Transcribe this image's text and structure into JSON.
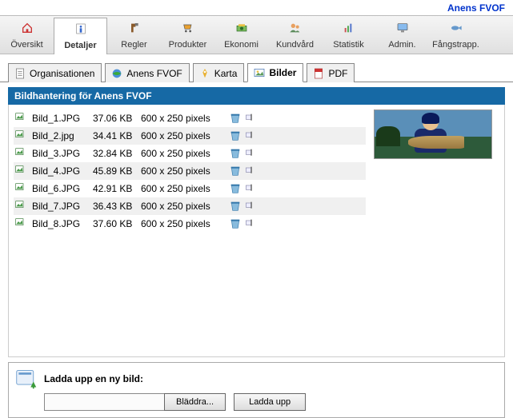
{
  "top_link": "Anens FVOF",
  "toolbar": [
    {
      "label": "Översikt",
      "icon": "home"
    },
    {
      "label": "Detaljer",
      "icon": "info",
      "active": true
    },
    {
      "label": "Regler",
      "icon": "hammer"
    },
    {
      "label": "Produkter",
      "icon": "cart"
    },
    {
      "label": "Ekonomi",
      "icon": "money"
    },
    {
      "label": "Kundvård",
      "icon": "users"
    },
    {
      "label": "Statistik",
      "icon": "chart"
    },
    {
      "label": "Admin.",
      "icon": "monitor"
    },
    {
      "label": "Fångstrapp.",
      "icon": "fish"
    }
  ],
  "tabs": [
    {
      "label": "Organisationen",
      "icon": "doc"
    },
    {
      "label": "Anens FVOF",
      "icon": "globe"
    },
    {
      "label": "Karta",
      "icon": "pin"
    },
    {
      "label": "Bilder",
      "icon": "image",
      "active": true
    },
    {
      "label": "PDF",
      "icon": "pdf"
    }
  ],
  "panel_title": "Bildhantering för Anens FVOF",
  "files": [
    {
      "name": "Bild_1.JPG",
      "size": "37.06 KB",
      "dim": "600 x 250 pixels"
    },
    {
      "name": "Bild_2.jpg",
      "size": "34.41 KB",
      "dim": "600 x 250 pixels"
    },
    {
      "name": "Bild_3.JPG",
      "size": "32.84 KB",
      "dim": "600 x 250 pixels"
    },
    {
      "name": "Bild_4.JPG",
      "size": "45.89 KB",
      "dim": "600 x 250 pixels"
    },
    {
      "name": "Bild_6.JPG",
      "size": "42.91 KB",
      "dim": "600 x 250 pixels"
    },
    {
      "name": "Bild_7.JPG",
      "size": "36.43 KB",
      "dim": "600 x 250 pixels"
    },
    {
      "name": "Bild_8.JPG",
      "size": "37.60 KB",
      "dim": "600 x 250 pixels"
    }
  ],
  "upload": {
    "label": "Ladda upp en ny bild:",
    "browse": "Bläddra...",
    "submit": "Ladda upp"
  }
}
